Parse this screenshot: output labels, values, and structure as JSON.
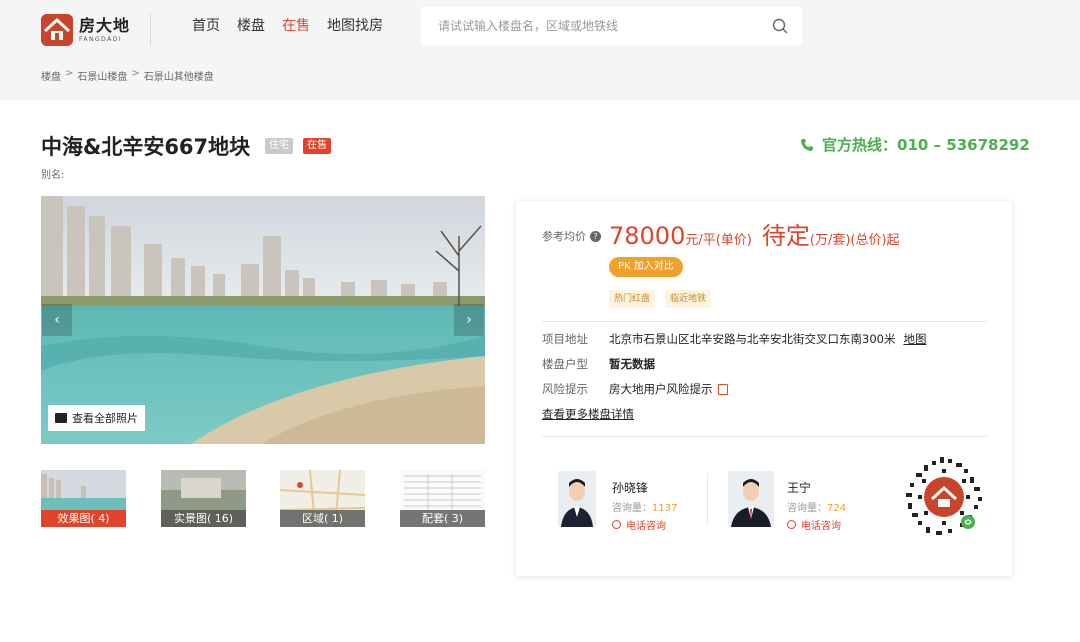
{
  "header": {
    "logo_cn": "房大地",
    "logo_en": "FANGDADI",
    "nav": [
      {
        "label": "首页",
        "active": false
      },
      {
        "label": "楼盘",
        "active": false
      },
      {
        "label": "在售",
        "active": true
      },
      {
        "label": "地图找房",
        "active": false
      }
    ],
    "search_placeholder": "请试试输入楼盘名，区域或地铁线"
  },
  "breadcrumb": [
    "楼盘",
    "石景山楼盘",
    "石景山其他楼盘"
  ],
  "project": {
    "title": "中海&北辛安667地块",
    "tag_type": "住宅",
    "tag_status": "在售",
    "alias_label": "别名:"
  },
  "hotline": "官方热线：010 – 53678292",
  "gallery": {
    "view_all": "查看全部照片",
    "prev": "‹",
    "next": "›",
    "thumbs": [
      {
        "label": "效果图( 4)",
        "active": true
      },
      {
        "label": "实景图( 16)",
        "active": false
      },
      {
        "label": "区域( 1)",
        "active": false
      },
      {
        "label": "配套( 3)",
        "active": false
      }
    ]
  },
  "price": {
    "label": "参考均价",
    "help": "?",
    "unit_price": "78000",
    "unit_price_suffix": "元/平(单价)",
    "total": "待定",
    "total_suffix": "(万/套)(总价)起"
  },
  "pk_button": "PK 加入对比",
  "features": [
    "热门红盘",
    "临近地铁"
  ],
  "details": {
    "address_label": "项目地址",
    "address": "北京市石景山区北辛安路与北辛安北街交叉口东南300米",
    "map_link": "地图",
    "layout_label": "楼盘户型",
    "layout_value": "暂无数据",
    "risk_label": "风险提示",
    "risk_value": "房大地用户风险提示",
    "more_link": "查看更多楼盘详情"
  },
  "agents": [
    {
      "name": "孙晓锋",
      "count_label": "咨询量：",
      "count": "1137",
      "call": "电话咨询"
    },
    {
      "name": "王宁",
      "count_label": "咨询量：",
      "count": "724",
      "call": "电话咨询"
    }
  ],
  "colors": {
    "accent": "#e0452b",
    "hotline": "#4caf50",
    "pk": "#f0a12b"
  }
}
